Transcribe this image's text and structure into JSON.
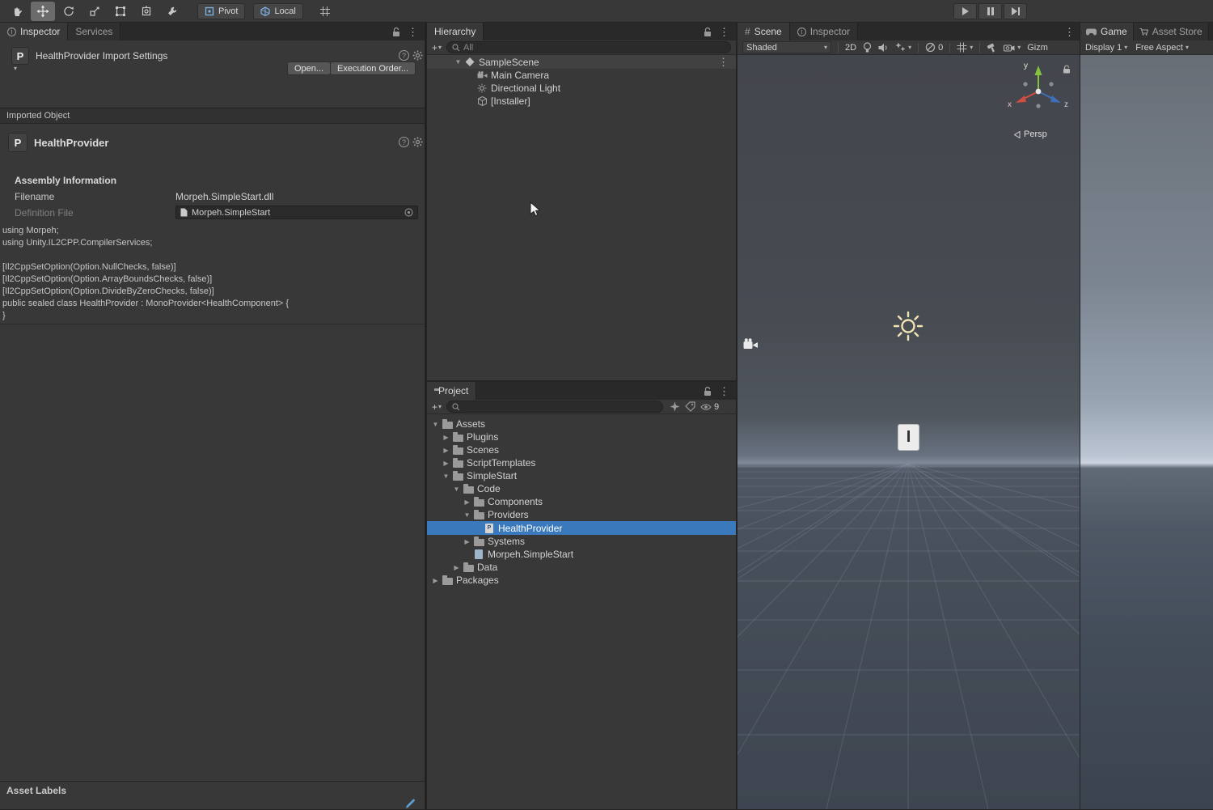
{
  "colors": {
    "selection_blue": "#3a79bb",
    "panel_bg": "#383838",
    "tab_bar_bg": "#292929",
    "axis_x_color": "#d04d43",
    "axis_y_color": "#84c13d",
    "axis_z_color": "#3e6fb8",
    "sun_gizmo_color": "#f2e3b3"
  },
  "icons": {
    "caret": "▾",
    "expanded": "▼",
    "collapsed": "▶",
    "kebab": "⋮",
    "plus": "+",
    "help": "?",
    "hash": "#",
    "info_i": "i"
  },
  "main_toolbar": {
    "pivot_label": "Pivot",
    "local_label": "Local"
  },
  "inspector_panel": {
    "tab_inspector": "Inspector",
    "tab_services": "Services",
    "title": "HealthProvider Import Settings",
    "title_icon_letter": "P",
    "open_button": "Open...",
    "execution_order_button": "Execution Order...",
    "imported_object_header": "Imported Object",
    "object_name": "HealthProvider",
    "object_icon_letter": "P",
    "assembly_information_header": "Assembly Information",
    "filename_label": "Filename",
    "filename_value": "Morpeh.SimpleStart.dll",
    "definition_file_label": "Definition File",
    "definition_file_value": "Morpeh.SimpleStart",
    "code_lines": [
      "using Morpeh;",
      "using Unity.IL2CPP.CompilerServices;",
      "",
      "[Il2CppSetOption(Option.NullChecks, false)]",
      "[Il2CppSetOption(Option.ArrayBoundsChecks, false)]",
      "[Il2CppSetOption(Option.DivideByZeroChecks, false)]",
      "public sealed class HealthProvider : MonoProvider<HealthComponent> {",
      "}"
    ],
    "asset_labels_header": "Asset Labels"
  },
  "hierarchy_panel": {
    "tab": "Hierarchy",
    "search_value": "All",
    "scene_label": "SampleScene",
    "items": [
      {
        "label": "Main Camera",
        "icon": "camera"
      },
      {
        "label": "Directional Light",
        "icon": "light"
      },
      {
        "label": "[Installer]",
        "icon": "gameobject"
      }
    ]
  },
  "project_panel": {
    "tab": "Project",
    "hidden_count": "9",
    "script_icon_letter": "P",
    "tree": [
      {
        "label": "Assets",
        "level": 0,
        "state": "expanded",
        "icon": "folder"
      },
      {
        "label": "Plugins",
        "level": 1,
        "state": "collapsed",
        "icon": "folder"
      },
      {
        "label": "Scenes",
        "level": 1,
        "state": "collapsed",
        "icon": "folder"
      },
      {
        "label": "ScriptTemplates",
        "level": 1,
        "state": "collapsed",
        "icon": "folder"
      },
      {
        "label": "SimpleStart",
        "level": 1,
        "state": "expanded",
        "icon": "folder"
      },
      {
        "label": "Code",
        "level": 2,
        "state": "expanded",
        "icon": "folder"
      },
      {
        "label": "Components",
        "level": 3,
        "state": "collapsed",
        "icon": "folder"
      },
      {
        "label": "Providers",
        "level": 3,
        "state": "expanded",
        "icon": "folder"
      },
      {
        "label": "HealthProvider",
        "level": 4,
        "state": "leaf",
        "icon": "script",
        "selected": true
      },
      {
        "label": "Systems",
        "level": 3,
        "state": "collapsed",
        "icon": "folder"
      },
      {
        "label": "Morpeh.SimpleStart",
        "level": 3,
        "state": "leaf",
        "icon": "asmdef"
      },
      {
        "label": "Data",
        "level": 2,
        "state": "collapsed",
        "icon": "folder"
      },
      {
        "label": "Packages",
        "level": 0,
        "state": "collapsed",
        "icon": "folder"
      }
    ]
  },
  "scene_panel": {
    "tab_scene": "Scene",
    "tab_inspector": "Inspector",
    "shading_mode": "Shaded",
    "toggle_2d": "2D",
    "hidden_count": "0",
    "gizmos_label": "Gizm",
    "persp_label": "Persp",
    "axis_x_label": "x",
    "axis_y_label": "y",
    "axis_z_label": "z",
    "installer_gizmo_letter": "I"
  },
  "game_panel": {
    "tab_game": "Game",
    "tab_asset_store": "Asset Store",
    "display_value": "Display 1",
    "aspect_value": "Free Aspect"
  }
}
